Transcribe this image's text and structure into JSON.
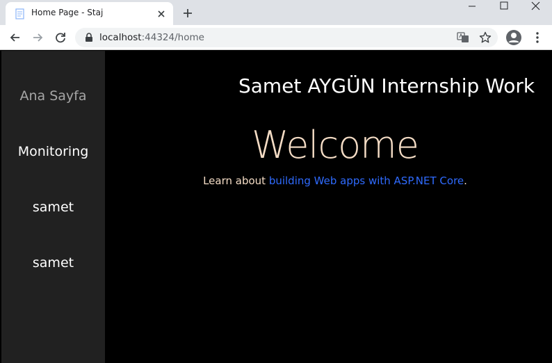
{
  "browser": {
    "tab_title": "Home Page - Staj",
    "url_host": "localhost",
    "url_path": ":44324/home"
  },
  "sidebar": {
    "items": [
      {
        "label": "Ana Sayfa"
      },
      {
        "label": "Monitoring"
      },
      {
        "label": "samet"
      },
      {
        "label": "samet"
      }
    ]
  },
  "main": {
    "site_title": "Samet AYGÜN Internship Work",
    "heading": "Welcome",
    "learn_prefix": "Learn about ",
    "learn_link": "building Web apps with ASP.NET Core",
    "learn_suffix": "."
  },
  "colors": {
    "sidebar_bg": "#212121",
    "page_bg": "#000000",
    "heading": "#f4dcc5",
    "link": "#2f6bff"
  }
}
